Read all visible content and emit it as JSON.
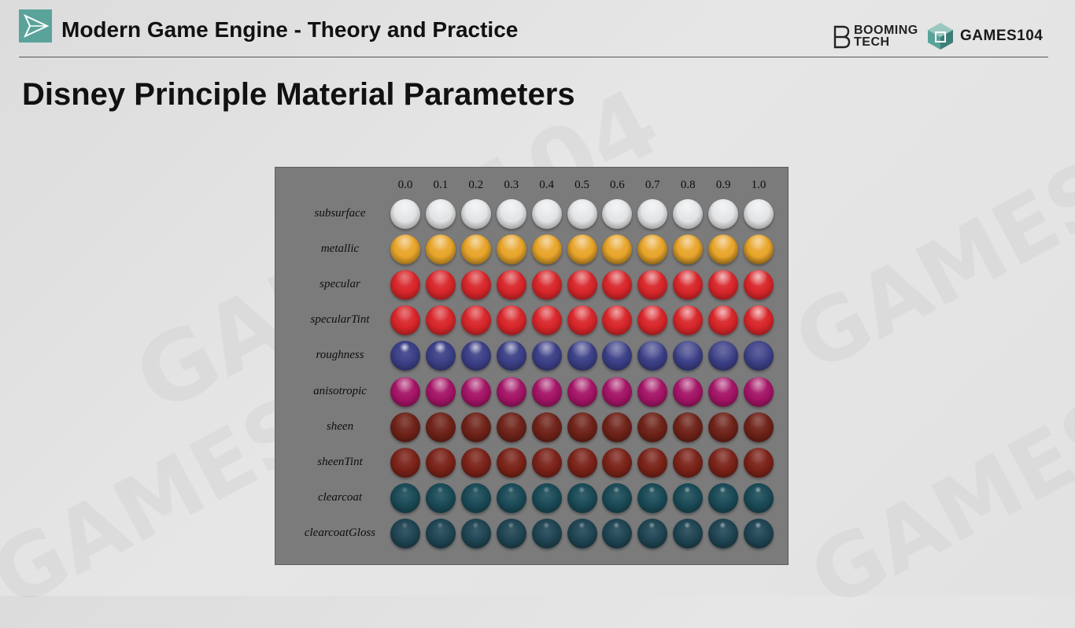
{
  "header": {
    "course_title": "Modern Game Engine - Theory and Practice",
    "logo_icon": "play-triangle-icon",
    "brand_booming": "BOOMING\nTECH",
    "brand_games": "GAMES104"
  },
  "slide": {
    "title": "Disney Principle Material Parameters"
  },
  "material_grid": {
    "columns": [
      "0.0",
      "0.1",
      "0.2",
      "0.3",
      "0.4",
      "0.5",
      "0.6",
      "0.7",
      "0.8",
      "0.9",
      "1.0"
    ],
    "rows": [
      {
        "label": "subsurface",
        "color": "#e2e4e6"
      },
      {
        "label": "metallic",
        "color": "#e8a52a"
      },
      {
        "label": "specular",
        "color": "#d8262a"
      },
      {
        "label": "specularTint",
        "color": "#d8262a"
      },
      {
        "label": "roughness",
        "color": "#3b3f86"
      },
      {
        "label": "anisotropic",
        "color": "#a41466"
      },
      {
        "label": "sheen",
        "color": "#6e2218"
      },
      {
        "label": "sheenTint",
        "color": "#7a2218"
      },
      {
        "label": "clearcoat",
        "color": "#1a4a56"
      },
      {
        "label": "clearcoatGloss",
        "color": "#1f4452"
      }
    ]
  }
}
